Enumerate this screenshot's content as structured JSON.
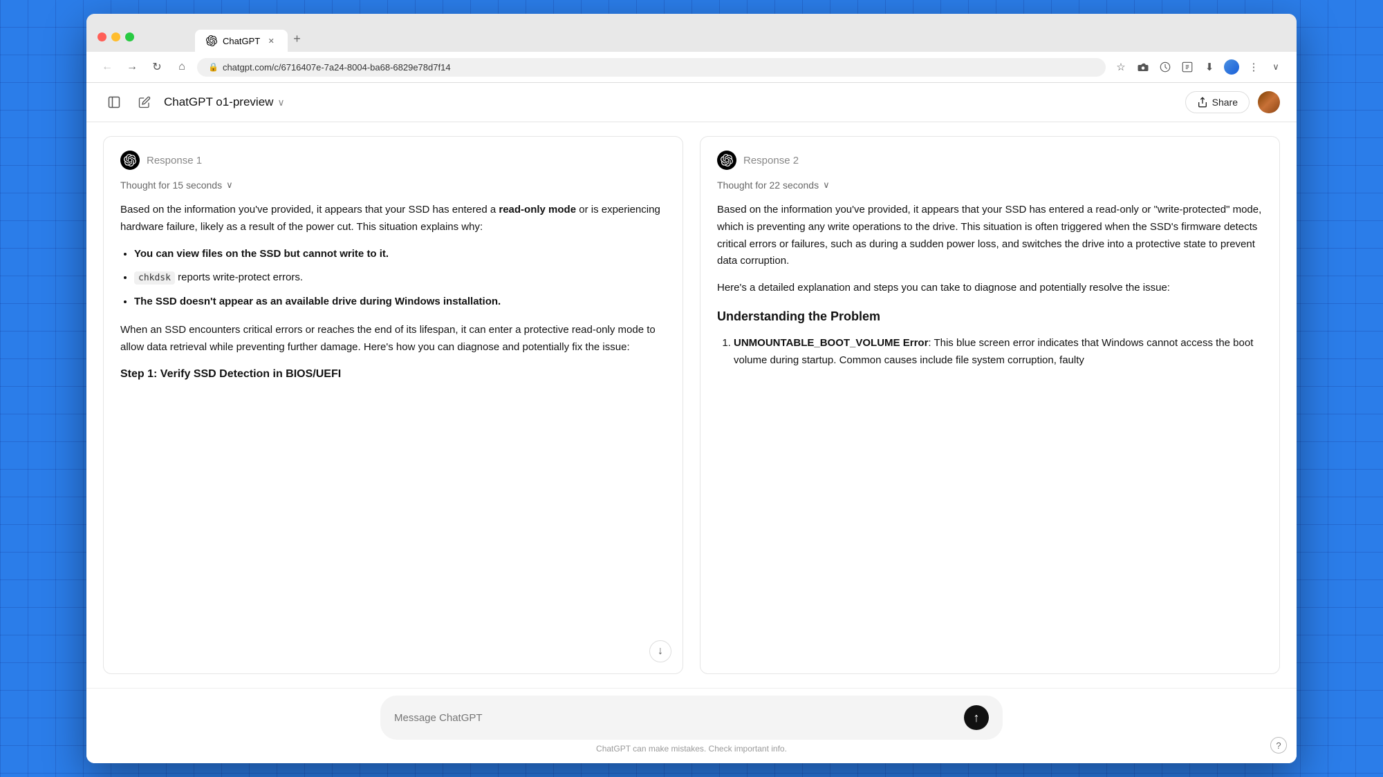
{
  "browser": {
    "url": "chatgpt.com/c/6716407e-7a24-8004-ba68-6829e78d7f14",
    "tab_label": "ChatGPT",
    "new_tab_label": "+"
  },
  "header": {
    "title": "ChatGPT o1-preview",
    "share_label": "Share"
  },
  "response1": {
    "label": "Response 1",
    "thought_label": "Thought for 15 seconds",
    "body_intro": "Based on the information you've provided, it appears that your SSD has entered a ",
    "bold1": "read-only mode",
    "body_intro2": " or is experiencing hardware failure, likely as a result of the power cut. This situation explains why:",
    "bullet1": "You can view files on the SSD but cannot write to it.",
    "bullet2_code": "chkdsk",
    "bullet2_rest": " reports write-protect errors.",
    "bullet3": "The SSD doesn't appear as an available drive during Windows installation.",
    "body_para2": "When an SSD encounters critical errors or reaches the end of its lifespan, it can enter a protective read-only mode to allow data retrieval while preventing further damage. Here's how you can diagnose and potentially fix the issue:",
    "step_heading": "Step 1: Verify SSD Detection in BIOS/UEFI"
  },
  "response2": {
    "label": "Response 2",
    "thought_label": "Thought for 22 seconds",
    "body_intro": "Based on the information you've provided, it appears that your SSD has entered a read-only or \"write-protected\" mode, which is preventing any write operations to the drive. This situation is often triggered when the SSD's firmware detects critical errors or failures, such as during a sudden power loss, and switches the drive into a protective state to prevent data corruption.",
    "body_para2": "Here's a detailed explanation and steps you can take to diagnose and potentially resolve the issue:",
    "section_heading": "Understanding the Problem",
    "list_item1_bold": "UNMOUNTABLE_BOOT_VOLUME Error",
    "list_item1_rest": ": This blue screen error indicates that Windows cannot access the boot volume during startup. Common causes include file system corruption, faulty"
  },
  "input": {
    "placeholder": "Message ChatGPT"
  },
  "footer": {
    "text": "ChatGPT can make mistakes. Check important info."
  },
  "icons": {
    "back": "←",
    "forward": "→",
    "refresh": "↻",
    "home": "⌂",
    "star": "☆",
    "download": "⬇",
    "more": "⋮",
    "send": "↑",
    "chevron_down": "∨",
    "share": "↑",
    "help": "?"
  }
}
